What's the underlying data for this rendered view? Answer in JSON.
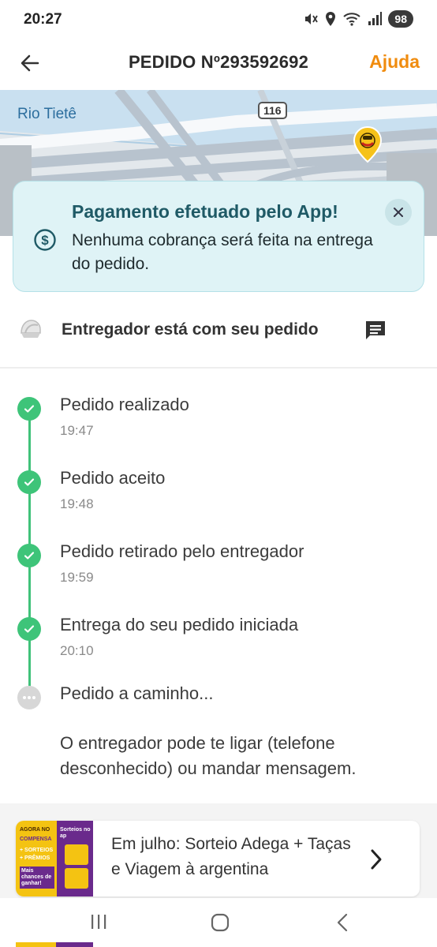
{
  "status_bar": {
    "time": "20:27",
    "battery": "98",
    "icons": [
      "mute-vibrate-icon",
      "location-icon",
      "wifi-6-icon",
      "signal-icon"
    ]
  },
  "header": {
    "title": "PEDIDO Nº293592692",
    "help_label": "Ajuda",
    "back_icon": "arrow-left-icon"
  },
  "map": {
    "river_label": "Rio Tietê",
    "road_badge": "116",
    "pin_icon": "delivery-pin-icon"
  },
  "notice": {
    "title": "Pagamento efetuado pelo App!",
    "body": "Nenhuma cobrança será feita na entrega do pedido.",
    "icon": "dollar-circle-icon",
    "close_icon": "close-icon"
  },
  "courier": {
    "text": "Entregador está com seu pedido",
    "chat_icon": "chat-icon"
  },
  "timeline": {
    "steps": [
      {
        "label": "Pedido realizado",
        "time": "19:47",
        "done": true
      },
      {
        "label": "Pedido aceito",
        "time": "19:48",
        "done": true
      },
      {
        "label": "Pedido retirado pelo entregador",
        "time": "19:59",
        "done": true
      },
      {
        "label": "Entrega do seu pedido iniciada",
        "time": "20:10",
        "done": true
      },
      {
        "label": "Pedido a caminho...",
        "time": "",
        "done": false
      }
    ],
    "description": "O entregador pode te ligar (telefone desconhecido) ou mandar mensagem."
  },
  "promo": {
    "text": "Em julho: Sorteio Adega + Taças e Viagem à argentina",
    "thumb": {
      "line1": "AGORA NO",
      "line2": "COMPENSA",
      "line3": "+ SORTEIOS",
      "line4": "+ PRÊMIOS",
      "line5": "Mais chances de ganhar!",
      "line6": "Sorteios no ap"
    }
  },
  "colors": {
    "accent_orange": "#f08c0f",
    "success_green": "#3ec479",
    "notice_bg": "#dff3f6",
    "notice_title": "#1f5a66"
  }
}
